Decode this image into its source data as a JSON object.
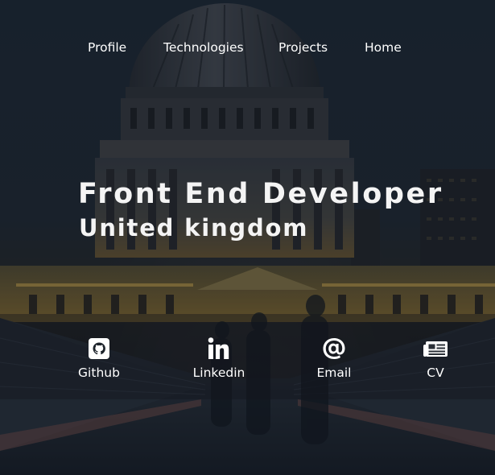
{
  "nav": {
    "items": [
      {
        "label": "Profile"
      },
      {
        "label": "Technologies"
      },
      {
        "label": "Projects"
      },
      {
        "label": "Home"
      }
    ]
  },
  "hero": {
    "title": "Front End Developer",
    "subtitle": "United kingdom"
  },
  "social": [
    {
      "label": "Github",
      "icon": "github-icon"
    },
    {
      "label": "Linkedin",
      "icon": "linkedin-icon"
    },
    {
      "label": "Email",
      "icon": "at-sign-icon"
    },
    {
      "label": "CV",
      "icon": "newspaper-icon"
    }
  ],
  "colors": {
    "text": "#ffffff",
    "night_sky": "#202b38",
    "overlay": "#14161c"
  }
}
